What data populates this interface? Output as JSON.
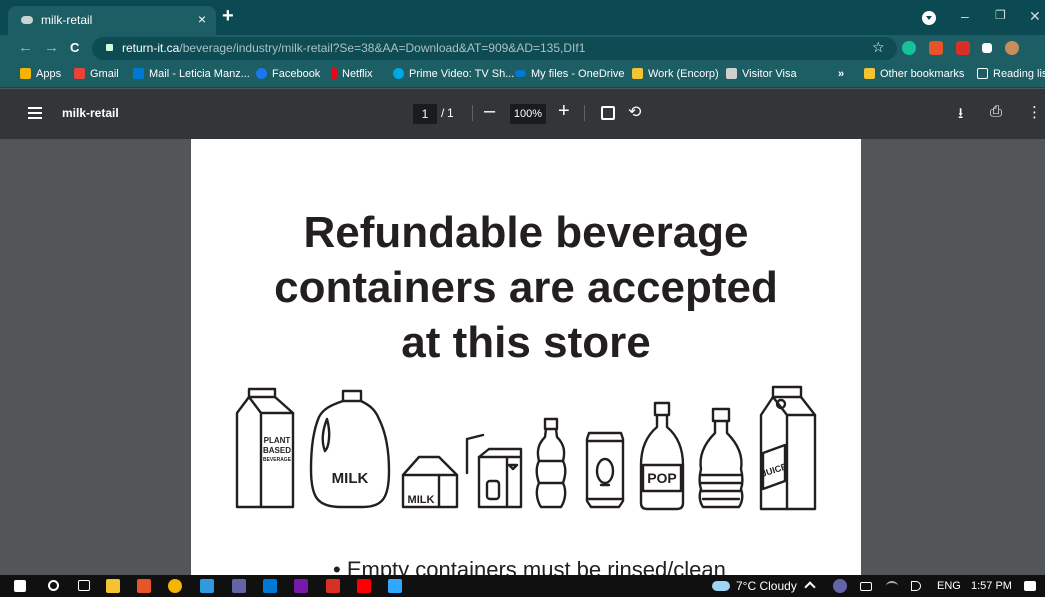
{
  "browser": {
    "tab_title": "milk-retail",
    "tab_close": "×",
    "new_tab": "+",
    "url_host": "return-it.ca",
    "url_path": "/beverage/industry/milk-retail?Se=38&AA=Download&AT=909&AD=135,DIf1",
    "nav_back": "←",
    "nav_forward": "→",
    "nav_reload": "C",
    "star": "☆",
    "win_minimize": "–",
    "win_restore": "❐",
    "win_close": "✕"
  },
  "bookmarks": [
    {
      "label": "Apps",
      "color": "#f4b400"
    },
    {
      "label": "Gmail",
      "color": "#ea4335"
    },
    {
      "label": "Mail - Leticia Manz...",
      "color": "#0078d4"
    },
    {
      "label": "Facebook",
      "color": "#1877f2"
    },
    {
      "label": "Netflix",
      "color": "#e50914"
    },
    {
      "label": "Prime Video: TV Sh...",
      "color": "#00a8e1"
    },
    {
      "label": "My files - OneDrive",
      "color": "#0078d4"
    },
    {
      "label": "Work (Encorp)",
      "color": "#f4c430"
    },
    {
      "label": "Visitor Visa",
      "color": "#cfcfcf"
    }
  ],
  "bookmarks_overflow": "»",
  "other_bookmarks": "Other bookmarks",
  "reading_list": "Reading list",
  "pdf_toolbar": {
    "title": "milk-retail",
    "page_current": "1",
    "page_sep": "/",
    "page_total": "1",
    "zoom_out": "–",
    "zoom": "100%",
    "zoom_in": "+",
    "rotate_icon": "⟲",
    "download_icon": "⭳",
    "print_icon": "⎙",
    "more_icon": "⋮"
  },
  "document": {
    "heading_lines": [
      "Refundable beverage",
      "containers are accepted",
      "at this store"
    ],
    "bullet": "• Empty containers must be rinsed/clean",
    "labels": {
      "plant": [
        "PLANT",
        "BASED",
        "BEVERAGE"
      ],
      "milk_jug": "MILK",
      "milk_small": "MILK",
      "pop": "POP",
      "juice": "JUICE"
    }
  },
  "taskbar": {
    "weather": "7°C  Cloudy",
    "lang": "ENG",
    "time": "1:57 PM"
  }
}
